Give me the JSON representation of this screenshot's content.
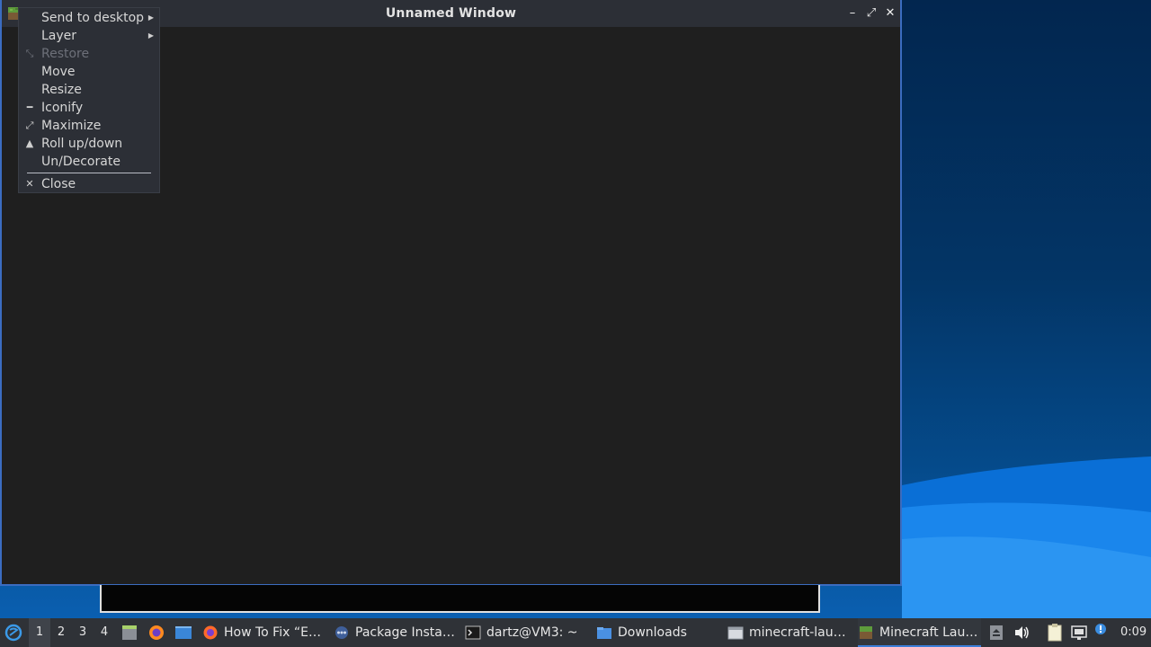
{
  "window": {
    "title": "Unnamed Window",
    "controls": {
      "minimize": "–",
      "maximize": "⤢",
      "close": "✕"
    }
  },
  "context_menu": {
    "items": [
      {
        "label": "Send to desktop",
        "icon": "",
        "submenu": true,
        "disabled": false
      },
      {
        "label": "Layer",
        "icon": "",
        "submenu": true,
        "disabled": false
      },
      {
        "label": "Restore",
        "icon": "restore-icon",
        "submenu": false,
        "disabled": true
      },
      {
        "label": "Move",
        "icon": "",
        "submenu": false,
        "disabled": false
      },
      {
        "label": "Resize",
        "icon": "",
        "submenu": false,
        "disabled": false
      },
      {
        "label": "Iconify",
        "icon": "iconify-icon",
        "submenu": false,
        "disabled": false
      },
      {
        "label": "Maximize",
        "icon": "maximize-icon",
        "submenu": false,
        "disabled": false
      },
      {
        "label": "Roll up/down",
        "icon": "rollup-icon",
        "submenu": false,
        "disabled": false
      },
      {
        "label": "Un/Decorate",
        "icon": "",
        "submenu": false,
        "disabled": false
      },
      {
        "label": "Close",
        "icon": "close-icon",
        "submenu": false,
        "disabled": false
      }
    ]
  },
  "taskbar": {
    "workspaces": [
      "1",
      "2",
      "3",
      "4"
    ],
    "active_workspace": "1",
    "tasks": [
      {
        "label": "How To Fix “E…",
        "icon": "firefox-icon"
      },
      {
        "label": "Package Insta…",
        "icon": "package-installer-icon"
      },
      {
        "label": "dartz@VM3: ~",
        "icon": "terminal-icon"
      },
      {
        "label": "Downloads",
        "icon": "folder-icon"
      },
      {
        "label": "minecraft-lau…",
        "icon": "window-icon"
      },
      {
        "label": "Minecraft Lau…",
        "icon": "minecraft-icon",
        "active": true
      }
    ],
    "clock": "0:09"
  },
  "colors": {
    "accent": "#3b7dd8",
    "titlebar": "#2c2f36",
    "window_bg": "#1f1f1f",
    "taskbar": "#2f3237"
  }
}
